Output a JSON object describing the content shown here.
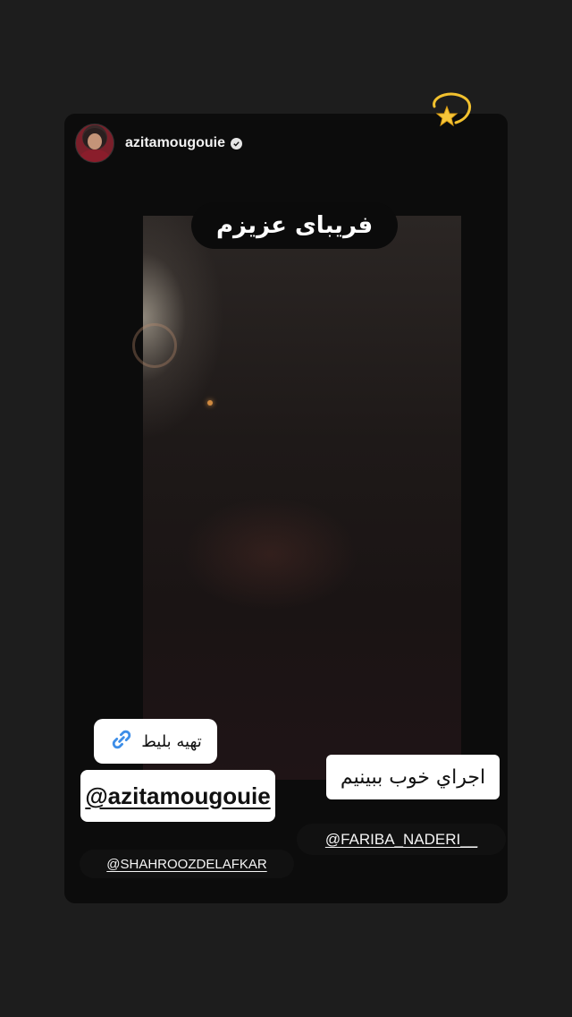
{
  "story": {
    "username": "azitamougouie",
    "verified": true,
    "title": "فریبای عزیزم",
    "link_sticker": {
      "label": "تهیه بلیط",
      "icon": "link-icon"
    },
    "mention_main": "@azitamougouie",
    "caption": "اجراي خوب ببينيم",
    "mention_fariba": "@FARIBA_NADERI__",
    "mention_shahrooz": "@SHAHROOZDELAFKAR",
    "emoji": "dizzy-star-icon"
  },
  "colors": {
    "background": "#1d1d1d",
    "card": "#0c0c0c",
    "link_blue": "#3d8ee8"
  }
}
